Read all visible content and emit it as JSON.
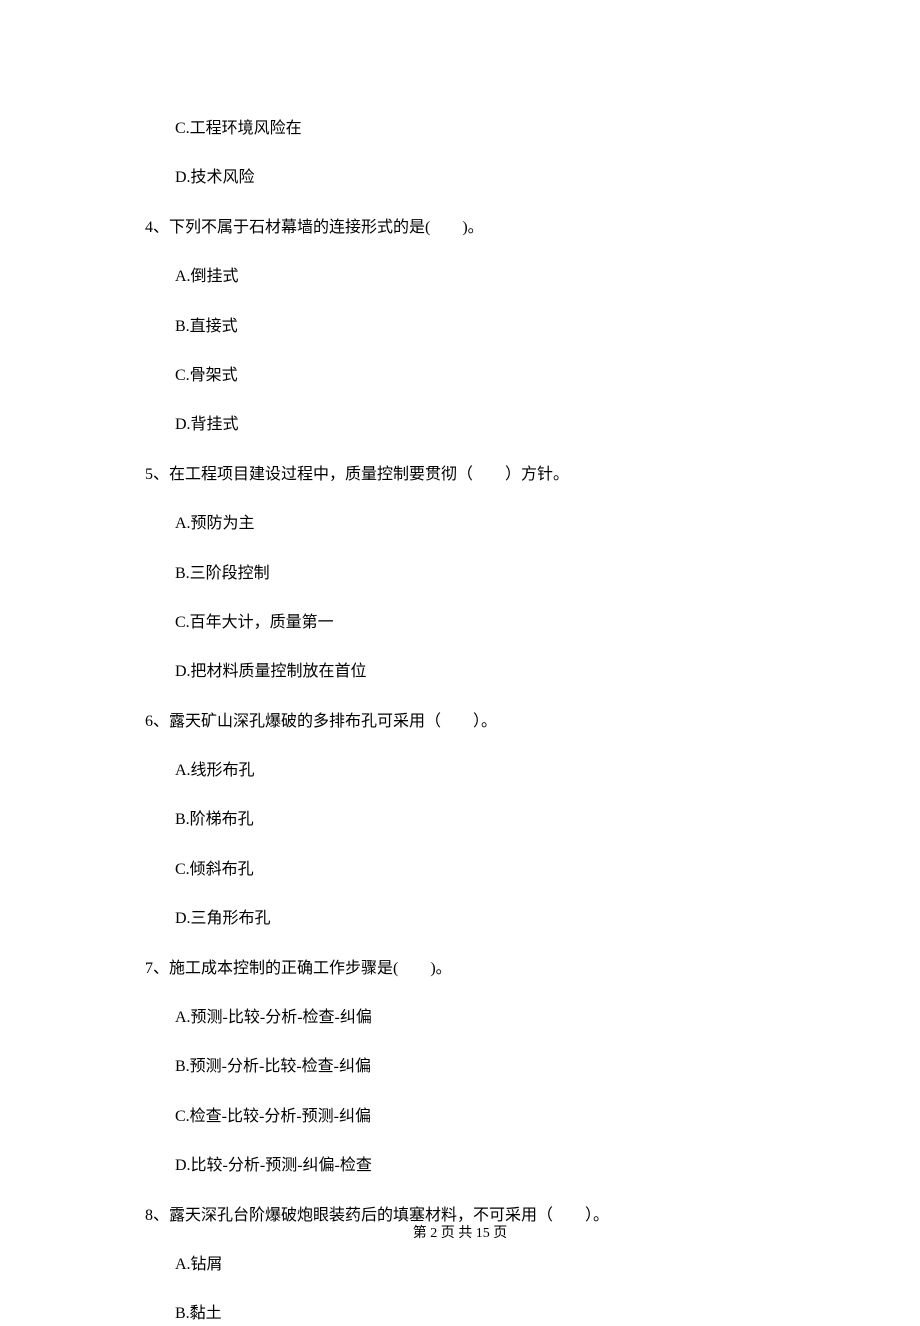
{
  "lines": {
    "opt_c_prev": "C.工程环境风险在",
    "opt_d_prev": "D.技术风险",
    "q4": "4、下列不属于石材幕墙的连接形式的是(　　)。",
    "q4_a": "A.倒挂式",
    "q4_b": "B.直接式",
    "q4_c": "C.骨架式",
    "q4_d": "D.背挂式",
    "q5": "5、在工程项目建设过程中，质量控制要贯彻（　　）方针。",
    "q5_a": "A.预防为主",
    "q5_b": "B.三阶段控制",
    "q5_c": "C.百年大计，质量第一",
    "q5_d": "D.把材料质量控制放在首位",
    "q6": "6、露天矿山深孔爆破的多排布孔可采用（　　）。",
    "q6_a": "A.线形布孔",
    "q6_b": "B.阶梯布孔",
    "q6_c": "C.倾斜布孔",
    "q6_d": "D.三角形布孔",
    "q7": "7、施工成本控制的正确工作步骤是(　　)。",
    "q7_a": "A.预测-比较-分析-检查-纠偏",
    "q7_b": "B.预测-分析-比较-检查-纠偏",
    "q7_c": "C.检查-比较-分析-预测-纠偏",
    "q7_d": "D.比较-分析-预测-纠偏-检查",
    "q8": "8、露天深孔台阶爆破炮眼装药后的填塞材料，不可采用（　　）。",
    "q8_a": "A.钻屑",
    "q8_b": "B.黏土"
  },
  "footer": "第 2 页 共 15 页"
}
